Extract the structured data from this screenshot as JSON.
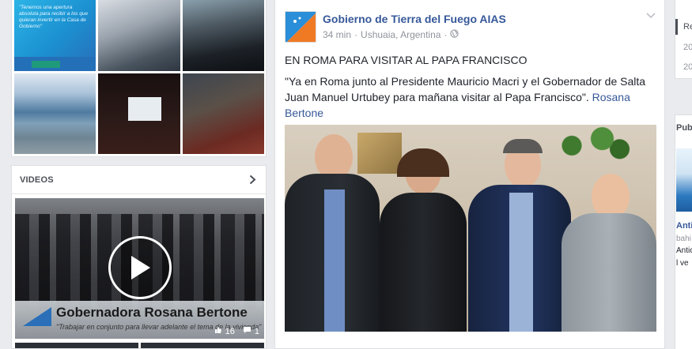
{
  "photos": {
    "tile1_text": "\"Tenemos una apertura absoluta para recibir a los que quieran invertir en la Casa de Gobierno\"",
    "tiles": [
      "photo-1",
      "photo-2",
      "photo-3",
      "photo-4",
      "photo-5",
      "photo-6"
    ]
  },
  "videos": {
    "title": "VIDEOS",
    "lower_third_name": "Gobernadora Rosana Bertone",
    "lower_third_quote": "\"Trabajar en conjunto para llevar adelante el tema de la vivienda\"",
    "likes": "16",
    "comments": "1"
  },
  "post": {
    "author": "Gobierno de Tierra del Fuego AIAS",
    "time": "34 min",
    "separator": "·",
    "location": "Ushuaia, Argentina",
    "headline": "EN ROMA PARA VISITAR AL PAPA FRANCISCO",
    "body": "\"Ya en Roma junto al Presidente Mauricio Macri y el Gobernador de Salta Juan Manuel Urtubey para mañana visitar al Papa Francisco\".",
    "body_link": "Rosana Bertone"
  },
  "right": {
    "top_item_1": "Re",
    "top_item_2": "20",
    "top_item_3": "20",
    "pub_label": "Pub",
    "pub_title": "Anti",
    "pub_source": "bahi",
    "pub_desc_1": "Antic",
    "pub_desc_2": "l ve"
  },
  "colors": {
    "link": "#365899",
    "background": "#e9ebee",
    "meta": "#90949c"
  }
}
